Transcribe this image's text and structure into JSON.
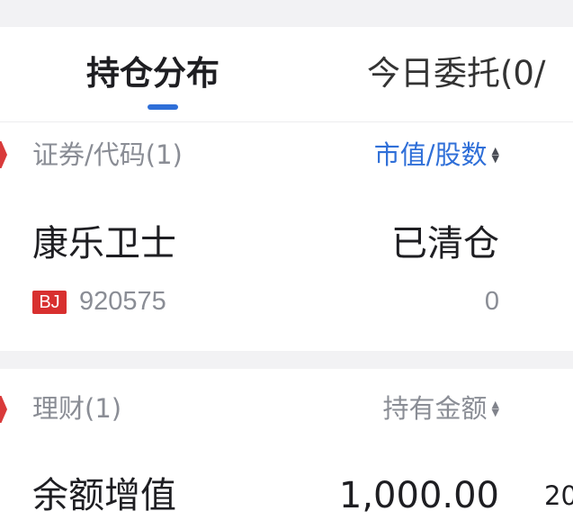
{
  "tabs": {
    "holdings_label": "持仓分布",
    "orders_label": "今日委托(0/"
  },
  "securities": {
    "header_left": "证券/代码(1)",
    "header_right": "市值/股数",
    "items": [
      {
        "name": "康乐卫士",
        "exchange_badge": "BJ",
        "code": "920575",
        "status": "已清仓",
        "shares": "0"
      }
    ]
  },
  "wealth": {
    "header_left": "理财(1)",
    "header_right": "持有金额",
    "items": [
      {
        "name": "余额增值",
        "amount": "1,000.00",
        "extra": "20"
      }
    ]
  },
  "colors": {
    "accent_blue": "#2f6fd8",
    "marker_red": "#d93a3a",
    "badge_red": "#d8302f"
  },
  "icons": [
    "sort-icon",
    "section-marker-icon"
  ]
}
